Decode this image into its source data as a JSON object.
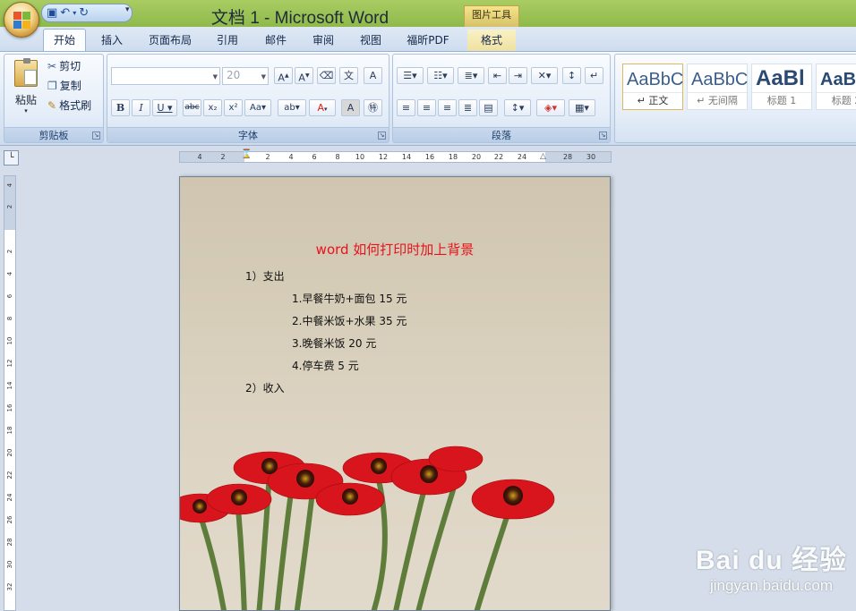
{
  "window": {
    "title": "文档 1 - Microsoft Word",
    "context_tab_group": "图片工具"
  },
  "ribbon_tabs": [
    "开始",
    "插入",
    "页面布局",
    "引用",
    "邮件",
    "审阅",
    "视图",
    "福昕PDF",
    "格式"
  ],
  "active_tab": "开始",
  "clipboard": {
    "paste": "粘贴",
    "cut": "剪切",
    "copy": "复制",
    "format_painter": "格式刷",
    "group_label": "剪贴板"
  },
  "font": {
    "size_value": "20",
    "group_label": "字体"
  },
  "paragraph": {
    "group_label": "段落"
  },
  "styles": [
    {
      "sample": "AaBbC",
      "name": "↵ 正文"
    },
    {
      "sample": "AaBbC",
      "name": "↵ 无间隔"
    },
    {
      "sample": "AaBl",
      "name": "标题 1"
    },
    {
      "sample": "AaBl",
      "name": "标题 2"
    }
  ],
  "ruler": {
    "h_labels": [
      "4",
      "2",
      "2",
      "4",
      "6",
      "8",
      "10",
      "12",
      "14",
      "16",
      "18",
      "20",
      "22",
      "24",
      "28",
      "30"
    ],
    "v_labels": [
      "4",
      "2",
      "2",
      "4",
      "6",
      "8",
      "10",
      "12",
      "14",
      "16",
      "18",
      "20",
      "22",
      "24",
      "26",
      "28",
      "30",
      "32"
    ]
  },
  "document": {
    "title": "word 如何打印时加上背景",
    "lines": [
      {
        "text": "1）支出",
        "indent": 0
      },
      {
        "text": "1.早餐牛奶+面包 15 元",
        "indent": 1
      },
      {
        "text": "2.中餐米饭+水果 35 元",
        "indent": 1
      },
      {
        "text": "3.晚餐米饭 20 元",
        "indent": 1
      },
      {
        "text": "4.停车费 5 元",
        "indent": 1
      },
      {
        "text": "2）收入",
        "indent": 0
      }
    ]
  },
  "watermark": {
    "logo": "Bai du 经验",
    "url": "jingyan.baidu.com"
  },
  "colors": {
    "title_bar": "#9cc357",
    "doc_title": "#e8121b",
    "flower": "#d8141c"
  }
}
